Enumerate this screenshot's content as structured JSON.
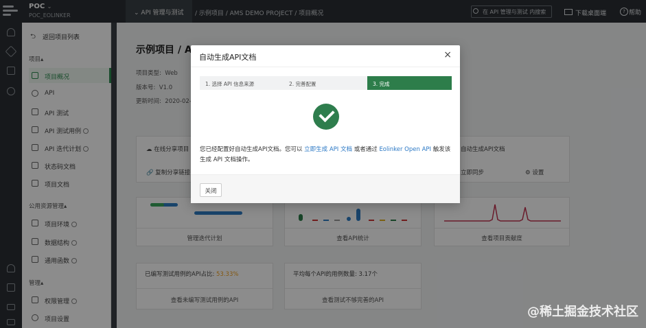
{
  "header": {
    "project_name": "POC",
    "project_sub": "POC_EOLINKER",
    "menu_label": "API 管理与测试",
    "breadcrumb": "/ 示例项目 / AMS DEMO PROJECT / 项目概况",
    "search_placeholder": "在 API 管理与测试 内搜索",
    "download_label": "下载桌面端",
    "help_label": "帮助"
  },
  "sidebar": {
    "back_label": "返回项目列表",
    "group_project": "项目",
    "items": [
      {
        "label": "项目概况"
      },
      {
        "label": "API"
      },
      {
        "label": "API 测试"
      },
      {
        "label": "API 测试用例"
      },
      {
        "label": "API 迭代计划"
      },
      {
        "label": "状态码文档"
      },
      {
        "label": "项目文档"
      }
    ],
    "group_public": "公用资源管理",
    "public_items": [
      {
        "label": "项目环境"
      },
      {
        "label": "数据结构"
      },
      {
        "label": "通用函数"
      }
    ],
    "group_manage": "管理",
    "manage_items": [
      {
        "label": "权限管理"
      },
      {
        "label": "项目设置"
      }
    ]
  },
  "main": {
    "title": "示例项目 / AMS DEMO PROJECT",
    "type_label": "项目类型:",
    "type_value": "Web",
    "version_label": "版本号:",
    "version_value": "V1.0",
    "updated_label": "更新时间:",
    "updated_value": "2020-02-",
    "share_label": "在线分享项目",
    "copy_share_label": "复制分享链接",
    "auto_doc_label": "自动生成API文档",
    "sync_label": "立即同步",
    "settings_label": "设置",
    "card1_footer": "管理迭代计划",
    "card2_footer": "查看API统计",
    "card3_footer": "查看项目贡献度",
    "stat1_label": "已编写测试用例的API占比:",
    "stat1_value": "53.33%",
    "stat1_footer": "查看未编写测试用例的API",
    "stat2_label": "平均每个API的用例数量:",
    "stat2_value": "3.17个",
    "stat2_footer": "查看测试不够完善的API"
  },
  "modal": {
    "title": "自动生成API文档",
    "close_glyph": "×",
    "steps": [
      "1. 选择 API 信息来源",
      "2. 完善配置",
      "3. 完成"
    ],
    "msg_part1": "您已经配置好自动生成API文档。您可以",
    "msg_link1": "立即生成 API 文档",
    "msg_part2": "或者通过",
    "msg_link2": "Eolinker Open API",
    "msg_part3": "触发该生成 API 文档操作。",
    "close_button": "关闭"
  },
  "watermark": "@稀土掘金技术社区",
  "colors": {
    "brand_green": "#2d7d4a",
    "link_blue": "#2b78c5",
    "stat_orange": "#f0a020"
  }
}
